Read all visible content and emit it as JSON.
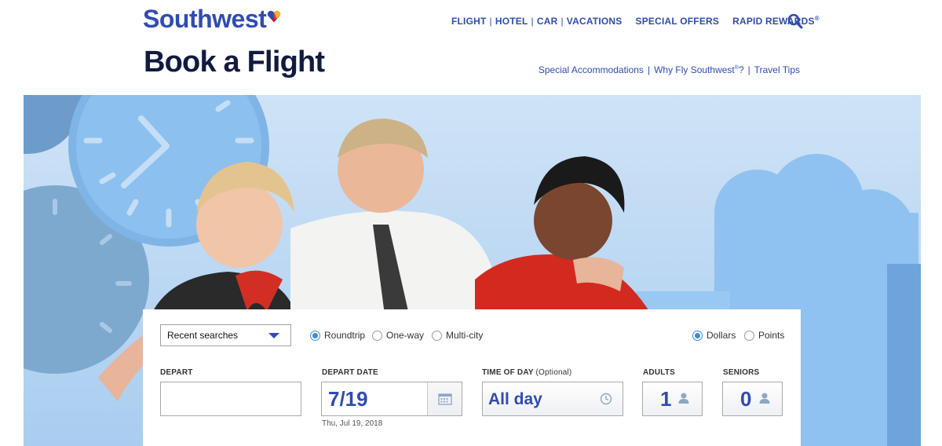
{
  "brand": {
    "name": "Southwest",
    "color": "#304cb2"
  },
  "topnav": {
    "products": [
      "FLIGHT",
      "HOTEL",
      "CAR",
      "VACATIONS"
    ],
    "special_offers": "SPECIAL OFFERS",
    "rapid_rewards": "RAPID REWARDS",
    "rapid_rewards_mark": "®",
    "search_icon": "search-icon"
  },
  "page_title": "Book a Flight",
  "sublinks": {
    "accommodations": "Special Accommodations",
    "why_fly": "Why Fly Southwest",
    "why_fly_mark": "®",
    "why_fly_suffix": "?",
    "travel_tips": "Travel Tips"
  },
  "form": {
    "recent_searches": "Recent searches",
    "trip_types": [
      {
        "label": "Roundtrip",
        "selected": true
      },
      {
        "label": "One-way",
        "selected": false
      },
      {
        "label": "Multi-city",
        "selected": false
      }
    ],
    "currency": [
      {
        "label": "Dollars",
        "selected": true
      },
      {
        "label": "Points",
        "selected": false
      }
    ],
    "depart": {
      "label": "DEPART",
      "value": ""
    },
    "depart_date": {
      "label": "DEPART DATE",
      "value": "7/19",
      "long_date": "Thu, Jul 19, 2018"
    },
    "time_of_day": {
      "label": "TIME OF DAY",
      "optional": "(Optional)",
      "value": "All day"
    },
    "adults": {
      "label": "ADULTS",
      "value": "1"
    },
    "seniors": {
      "label": "SENIORS",
      "value": "0"
    }
  }
}
